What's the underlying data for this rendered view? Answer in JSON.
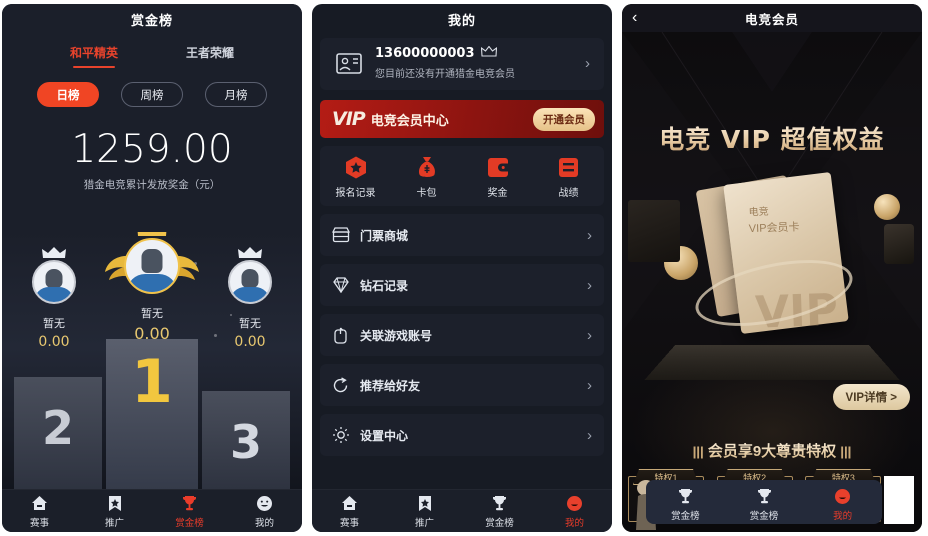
{
  "panels": {
    "rank": {
      "header_title": "赏金榜",
      "game_tabs": [
        {
          "label": "和平精英",
          "active": true
        },
        {
          "label": "王者荣耀",
          "active": false
        }
      ],
      "period_chips": [
        {
          "label": "日榜",
          "active": true
        },
        {
          "label": "周榜",
          "active": false
        },
        {
          "label": "月榜",
          "active": false
        }
      ],
      "total_amount": "1259.00",
      "total_label": "猎金电竞累计发放奖金（元）",
      "podium": [
        {
          "rank": "2",
          "name": "暂无",
          "score": "0.00"
        },
        {
          "rank": "1",
          "name": "暂无",
          "score": "0.00"
        },
        {
          "rank": "3",
          "name": "暂无",
          "score": "0.00"
        }
      ]
    },
    "mine": {
      "header_title": "我的",
      "user": {
        "phone": "13600000003",
        "subtitle": "您目前还没有开通猎金电竞会员",
        "crown_icon": "crown-icon",
        "avatar_icon": "user-card-icon",
        "chevron": "›"
      },
      "vip_banner": {
        "logo": "VIP",
        "title": "电竞会员中心",
        "button_label": "开通会员"
      },
      "quick_actions": [
        {
          "label": "报名记录",
          "icon": "hexagon-star-icon"
        },
        {
          "label": "卡包",
          "icon": "money-bag-icon"
        },
        {
          "label": "奖金",
          "icon": "wallet-icon"
        },
        {
          "label": "战绩",
          "icon": "list-icon"
        }
      ],
      "menu_items": [
        {
          "label": "门票商城",
          "icon": "store-icon",
          "chevron": "›"
        },
        {
          "label": "钻石记录",
          "icon": "diamond-icon",
          "chevron": "›"
        },
        {
          "label": "关联游戏账号",
          "icon": "link-account-icon",
          "chevron": "›"
        },
        {
          "label": "推荐给好友",
          "icon": "share-icon",
          "chevron": "›"
        },
        {
          "label": "设置中心",
          "icon": "gear-icon",
          "chevron": "›"
        }
      ]
    },
    "vip": {
      "header_title": "电竞会员",
      "back_icon": "‹",
      "hero_title": "电竞 VIP 超值权益",
      "card_line1": "电竞",
      "card_line2": "VIP会员卡",
      "card_watermark": "VIP",
      "detail_button": "VIP详情 >",
      "privilege_heading": "会员享9大尊贵特权",
      "privilege_bars_left": "|||",
      "privilege_bars_right": "|||",
      "privileges": [
        {
          "label": "特权1"
        },
        {
          "label": "特权2"
        },
        {
          "label": "特权3"
        }
      ],
      "privilege_arrow": "›"
    }
  },
  "bottom_nav": {
    "panel1": [
      {
        "label": "赛事",
        "icon": "home-icon",
        "active": false
      },
      {
        "label": "推广",
        "icon": "bookmark-star-icon",
        "active": false
      },
      {
        "label": "赏金榜",
        "icon": "trophy-icon",
        "active": true
      },
      {
        "label": "我的",
        "icon": "smiley-icon",
        "active": false
      }
    ],
    "panel2": [
      {
        "label": "赛事",
        "icon": "home-icon",
        "active": false
      },
      {
        "label": "推广",
        "icon": "bookmark-star-icon",
        "active": false
      },
      {
        "label": "赏金榜",
        "icon": "trophy-icon",
        "active": false
      },
      {
        "label": "我的",
        "icon": "smiley-icon",
        "active": true
      }
    ],
    "panel3": [
      {
        "label": "赏金榜",
        "icon": "trophy-icon",
        "active": false
      },
      {
        "label": "赏金榜",
        "icon": "trophy-icon",
        "active": false
      },
      {
        "label": "我的",
        "icon": "smiley-icon",
        "active": true
      }
    ]
  },
  "colors": {
    "accent_red": "#ea3c2a",
    "chip_active": "#f04524",
    "gold": "#e8c870",
    "panel_bg": "#1b1f2a",
    "card_bg": "#1c202b",
    "vip_red": "#b41c15",
    "vip_gold": "#e6c288"
  }
}
